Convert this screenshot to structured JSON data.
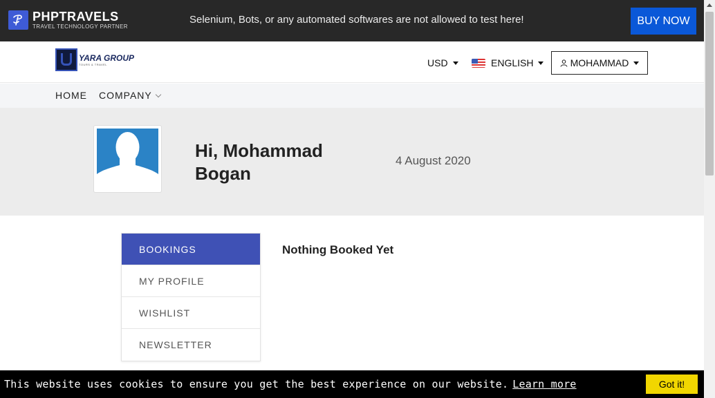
{
  "topbar": {
    "brand_name": "PHPTRAVELS",
    "brand_tagline": "TRAVEL TECHNOLOGY PARTNER",
    "notice": "Selenium, Bots, or any automated softwares are not allowed to test here!",
    "buy_label": "BUY NOW"
  },
  "header": {
    "logo_name": "YARA GROUP",
    "logo_sub": "TOURS & TRAVEL",
    "currency": "USD",
    "language": "ENGLISH",
    "user_name": "MOHAMMAD"
  },
  "nav": {
    "home": "HOME",
    "company": "COMPANY"
  },
  "profile": {
    "greeting": "Hi, Mohammad Bogan",
    "date": "4 August 2020"
  },
  "sidebar": {
    "items": [
      {
        "label": "BOOKINGS",
        "active": true
      },
      {
        "label": "MY PROFILE",
        "active": false
      },
      {
        "label": "WISHLIST",
        "active": false
      },
      {
        "label": "NEWSLETTER",
        "active": false
      }
    ]
  },
  "main": {
    "empty_message": "Nothing Booked Yet"
  },
  "cookie": {
    "message": "This website uses cookies to ensure you get the best experience on our website.",
    "link": "Learn more",
    "button": "Got it!"
  },
  "colors": {
    "topbar_bg": "#282828",
    "buy_button": "#0a58d8",
    "active_tab": "#3f51b5",
    "cookie_button": "#f1d600"
  }
}
